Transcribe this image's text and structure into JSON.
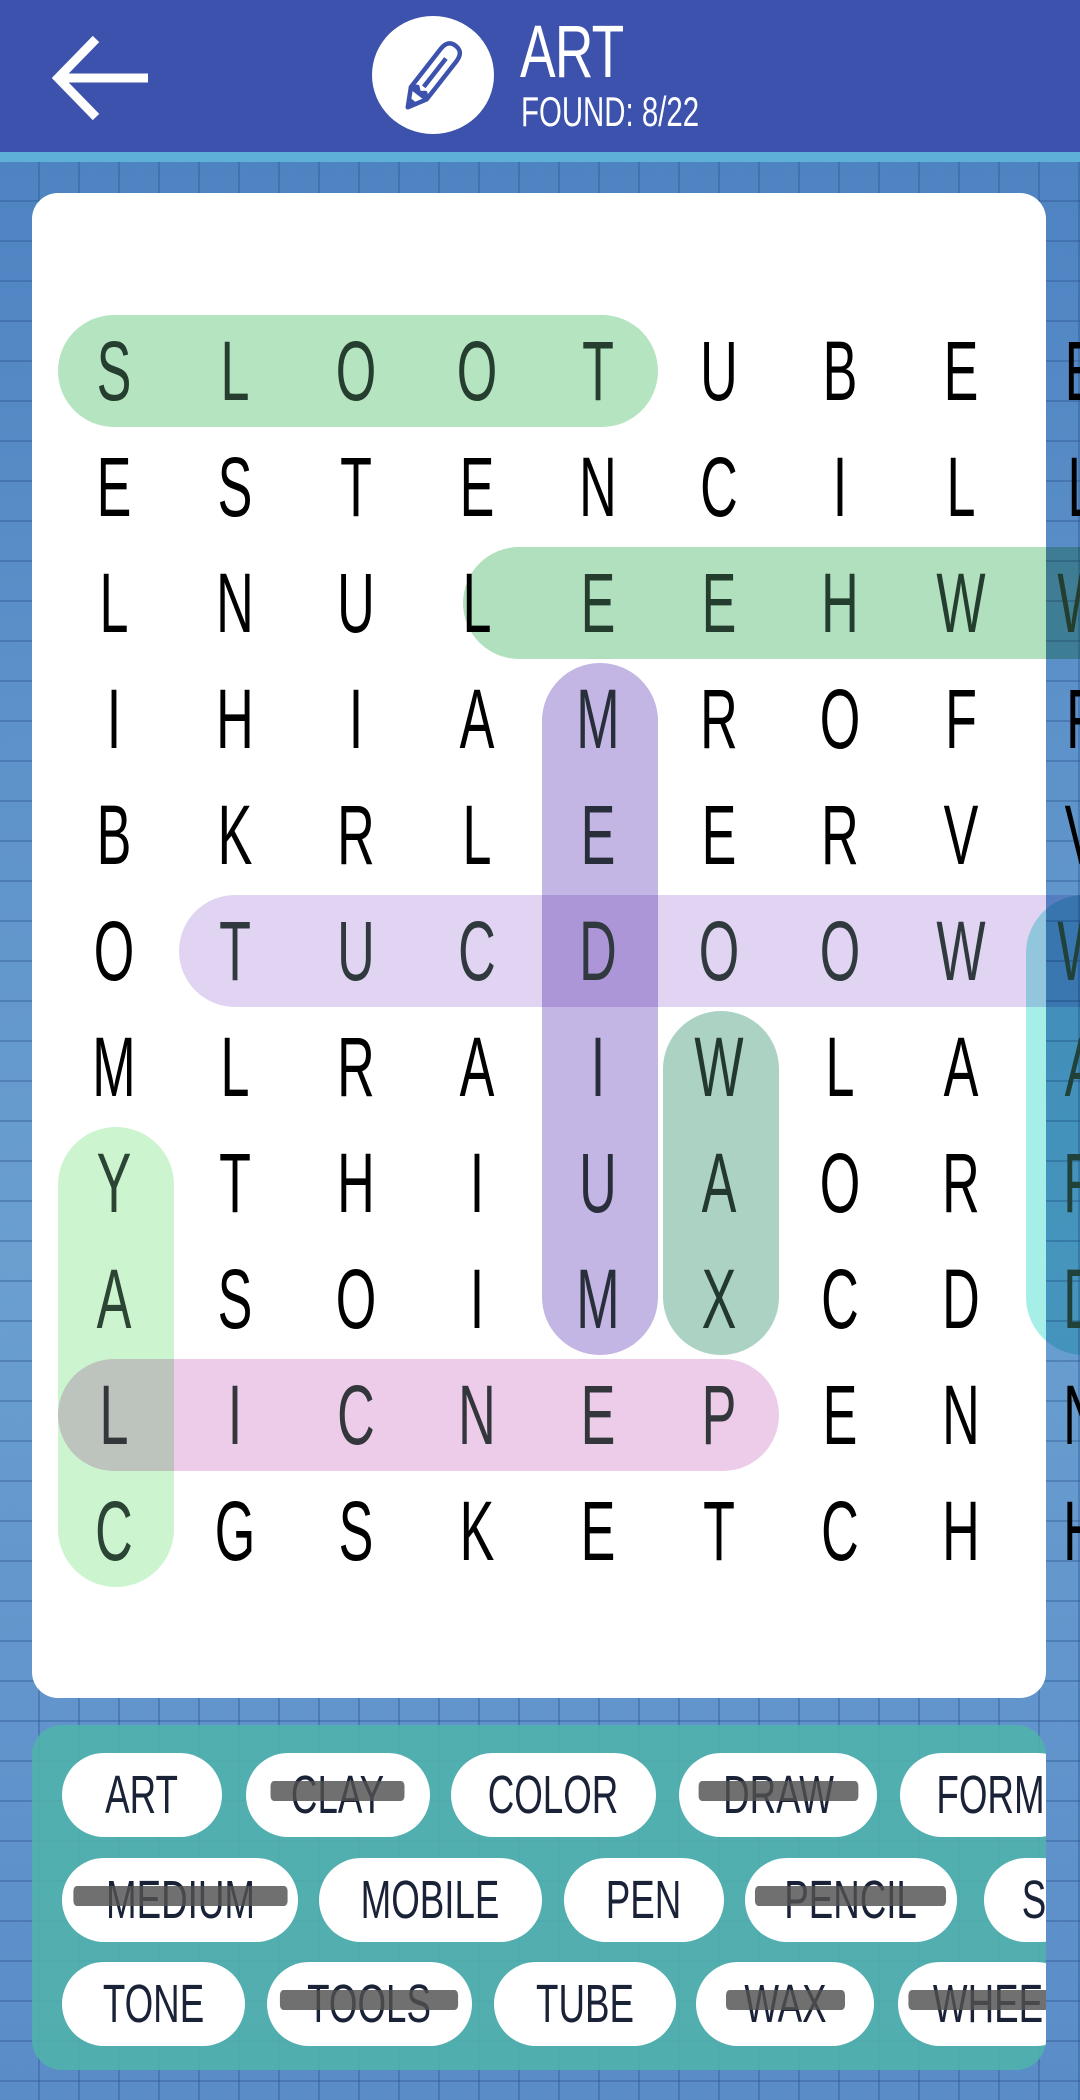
{
  "header": {
    "title": "ART",
    "found_label": "FOUND: 8/22",
    "back_icon": "arrow-left-icon",
    "category_icon": "pencil-icon",
    "bg_color": "#3c52ac"
  },
  "grid": {
    "rows": [
      [
        "S",
        "L",
        "O",
        "O",
        "T",
        "U",
        "B",
        "E",
        "E"
      ],
      [
        "E",
        "S",
        "T",
        "E",
        "N",
        "C",
        "I",
        "L",
        "L"
      ],
      [
        "L",
        "N",
        "U",
        "L",
        "E",
        "E",
        "H",
        "W",
        "W"
      ],
      [
        "I",
        "H",
        "I",
        "A",
        "M",
        "R",
        "O",
        "F",
        "F"
      ],
      [
        "B",
        "K",
        "R",
        "L",
        "E",
        "E",
        "R",
        "V",
        "V"
      ],
      [
        "O",
        "T",
        "U",
        "C",
        "D",
        "O",
        "O",
        "W",
        "W"
      ],
      [
        "M",
        "L",
        "R",
        "A",
        "I",
        "W",
        "L",
        "A",
        "A"
      ],
      [
        "Y",
        "T",
        "H",
        "I",
        "U",
        "A",
        "O",
        "R",
        "R"
      ],
      [
        "A",
        "S",
        "O",
        "I",
        "M",
        "X",
        "C",
        "D",
        "D"
      ],
      [
        "L",
        "I",
        "C",
        "N",
        "E",
        "P",
        "E",
        "N",
        "N"
      ],
      [
        "C",
        "G",
        "S",
        "K",
        "E",
        "T",
        "C",
        "H",
        "H"
      ]
    ],
    "found_highlights": [
      {
        "word": "TOOLS",
        "letters": "SLOOT",
        "color": "#a8dfb5"
      },
      {
        "word": "WHEEL",
        "letters": "LEEHW",
        "color": "#a2dbb2"
      },
      {
        "word": "MEDIUM",
        "letters": "MEDIUM",
        "color": "#b9a8df"
      },
      {
        "word": "WOODCUT",
        "letters": "TUCDOOW",
        "color": "#dccdf0"
      },
      {
        "word": "WAX",
        "letters": "WAX",
        "color": "#9ecab9"
      },
      {
        "word": "DRAW",
        "letters": "WARD",
        "color": "#96ece4"
      },
      {
        "word": "CLAY",
        "letters": "YALC",
        "color": "#c3f3c7"
      },
      {
        "word": "PENCIL",
        "letters": "LICNEP",
        "color": "#eac3e5"
      }
    ]
  },
  "word_bank": {
    "rows": [
      [
        {
          "label": "ART",
          "found": false
        },
        {
          "label": "CLAY",
          "found": true
        },
        {
          "label": "COLOR",
          "found": false
        },
        {
          "label": "DRAW",
          "found": true
        },
        {
          "label": "FORM",
          "found": false
        }
      ],
      [
        {
          "label": "MEDIUM",
          "found": true
        },
        {
          "label": "MOBILE",
          "found": false
        },
        {
          "label": "PEN",
          "found": false
        },
        {
          "label": "PENCIL",
          "found": true
        },
        {
          "label": "S",
          "found": false
        }
      ],
      [
        {
          "label": "TONE",
          "found": false
        },
        {
          "label": "TOOLS",
          "found": true
        },
        {
          "label": "TUBE",
          "found": false
        },
        {
          "label": "WAX",
          "found": true
        },
        {
          "label": "WHEE",
          "found": true
        }
      ]
    ]
  }
}
